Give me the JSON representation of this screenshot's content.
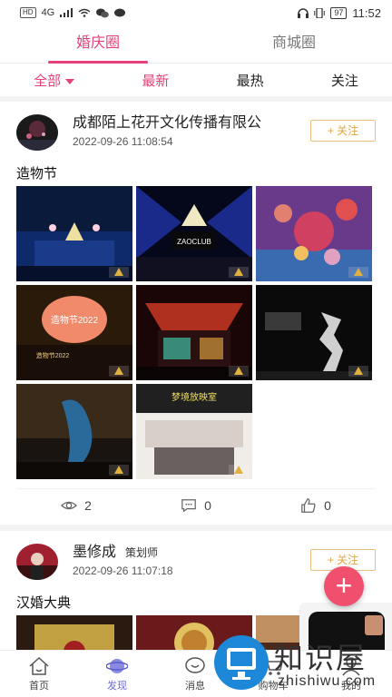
{
  "status_bar": {
    "left_label": "HD",
    "signal": "4G",
    "battery": "97",
    "time": "11:52"
  },
  "top_tabs": [
    {
      "label": "婚庆圈"
    },
    {
      "label": "商城圈"
    }
  ],
  "filters": [
    {
      "label": "全部"
    },
    {
      "label": "最新"
    },
    {
      "label": "最热"
    },
    {
      "label": "关注"
    }
  ],
  "posts": [
    {
      "author": "成都陌上花开文化传播有限公",
      "role": "",
      "time": "2022-09-26 11:08:54",
      "follow_label": "+ 关注",
      "title": "造物节",
      "views": "2",
      "comments": "0",
      "likes": "0"
    },
    {
      "author": "墨修成",
      "role": "策划师",
      "time": "2022-09-26 11:07:18",
      "follow_label": "+ 关注",
      "title": "汉婚大典"
    }
  ],
  "image_text": {
    "club_sign": "ZAOCLUB",
    "lantern_text": "造物节2022",
    "banner_text": "造物节2022",
    "dream_sign": "梦境放映室"
  },
  "bottom_nav": [
    {
      "label": "首页"
    },
    {
      "label": "发现"
    },
    {
      "label": "消息"
    },
    {
      "label": "购物车"
    },
    {
      "label": "我的"
    }
  ],
  "fab_label": "+",
  "watermark": {
    "title": "知识屋",
    "sub": "zhishiwu.com"
  }
}
